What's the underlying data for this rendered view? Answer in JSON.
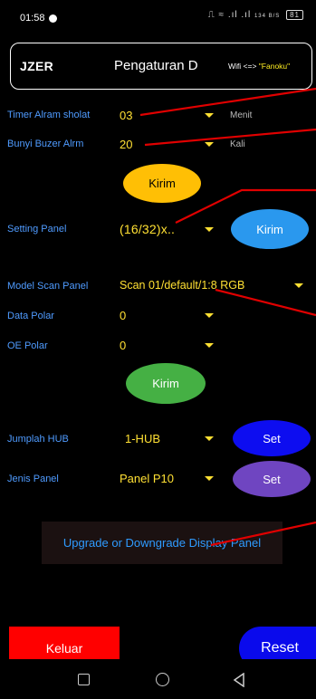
{
  "status": {
    "time": "01:58",
    "icons_text": "⎍ ≈ .ıl .ıl",
    "speed": "134 B/S",
    "battery": "81"
  },
  "header": {
    "left_text": "JZER",
    "title": "Pengaturan D",
    "wifi_prefix": "Wifi <=> ",
    "wifi_ssid": "\"Fanoku\""
  },
  "form": {
    "timer_label": "Timer Alram sholat",
    "timer_value": "03",
    "timer_unit": "Menit",
    "buzzer_label": "Bunyi Buzer Alrm",
    "buzzer_value": "20",
    "buzzer_unit": "Kali",
    "send1_label": "Kirim",
    "panel_label": "Setting Panel",
    "panel_value": "(16/32)x..",
    "send2_label": "Kirim",
    "scan_label": "Model Scan Panel",
    "scan_value": "Scan 01/default/1:8 RGB",
    "data_polar_label": "Data Polar",
    "data_polar_value": "0",
    "oe_polar_label": "OE Polar",
    "oe_polar_value": "0",
    "send3_label": "Kirim",
    "hub_label": "Jumplah HUB",
    "hub_value": "1-HUB",
    "hub_set_label": "Set",
    "panel_type_label": "Jenis Panel",
    "panel_type_value": "Panel P10",
    "panel_type_set_label": "Set"
  },
  "upgrade_label": "Upgrade or Downgrade Display Panel",
  "footer": {
    "exit_label": "Keluar",
    "reset_label": "Reset"
  },
  "colors": {
    "label_blue": "#4f9bff",
    "value_yellow": "#ffe033",
    "annotation_red": "#e00000"
  }
}
